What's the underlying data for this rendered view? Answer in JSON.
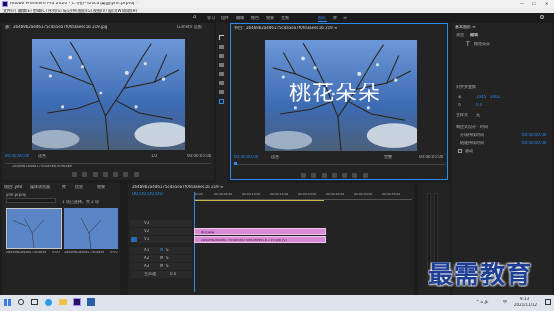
{
  "titlebar": {
    "app_title": "Adobe Premiere Pro 2020 - C:\\用户\\0\\lcu\\桌面\\yml.prproj *",
    "controls": [
      "—",
      "☐",
      "✕"
    ]
  },
  "menubar": {
    "items": [
      "文件(F)",
      "编辑(E)",
      "剪辑(C)",
      "序列(S)",
      "标记(M)",
      "图形(G)",
      "视图(V)",
      "窗口(W)",
      "帮助(H)"
    ]
  },
  "workspace_tabs": {
    "home": "⌂",
    "items": [
      "学习",
      "组件",
      "编辑",
      "颜色",
      "效果",
      "音频",
      "图形",
      "库",
      "≫"
    ],
    "active_index": 6
  },
  "source_monitor": {
    "tab": "源：2b4b9b2a4d6175c4a5ea7f0fd3aeec1b 219.jpg",
    "alt_tab": "Lumetri 范围",
    "timecode_left": "00;00;00;00",
    "fit": "适合",
    "page": "1/2",
    "timecode_right": "00:00:05:00",
    "clip_label": "2b4b9b2a4d6175c4a5ea7f0fd3aeec1b 219.jpg"
  },
  "program_monitor": {
    "tab": "节目：2b4b9b2a4d6175c4a5ea7f0fd3aeec1b 219 ≡",
    "overlay_title": "桃花朵朵",
    "timecode_left": "00;00;00;00",
    "fit": "适合",
    "quality": "完整",
    "timecode_right": "00:00:05:00"
  },
  "effect_controls": {
    "title": "基本图形 ≡",
    "tabs": [
      "浏览",
      "编辑"
    ],
    "layer_name": "桃花朵朵",
    "section_align": "对齐并变换",
    "fields": [
      {
        "label": "⊕",
        "value": "1045",
        "value2": "1061"
      },
      {
        "label": "↻",
        "value": "0.0",
        "value2": ""
      }
    ],
    "section_master": "主样式",
    "master_value": "无",
    "section_text": "响应式设计 - 时间",
    "items": [
      {
        "label": "开场持续时间",
        "value": "00:00:00:00"
      },
      {
        "label": "结尾持续时间",
        "value": "00:00:00:00"
      },
      {
        "label": "滚动",
        "value": ""
      }
    ]
  },
  "project_panel": {
    "tabs": [
      "项目: yml",
      "媒体浏览器",
      "库",
      "信息",
      "效果"
    ],
    "path": "yml.prproj",
    "count": "1 项已选择，共 2 项",
    "items": [
      {
        "name": "2b4b9b2a4d6175c4a5ea7f0fd3aeec1b 219.jpg",
        "duration": "5:00"
      },
      {
        "name": "2b4b9b2a4d6175c4a5ea7f0fd3aeec1b 219",
        "duration": "5:00"
      }
    ]
  },
  "timeline": {
    "tab": "2b4b9b2a4d6175c4a5ea7f0fd3aeec1b 219 ≡",
    "timecode": "00;00;00;00",
    "ruler": [
      "00;00",
      "00;00;05;00",
      "00;00;10;00",
      "00;00;15;00",
      "00;00;20;00",
      "00;00;25;00",
      "00;00;30;00",
      "00;00;35;00"
    ],
    "video_tracks": [
      "V3",
      "V2",
      "V1"
    ],
    "audio_tracks": [
      "A1",
      "A2",
      "A3"
    ],
    "master": "主声道",
    "master_value": "0.0",
    "clip_title": "桃花朵朵",
    "clip_image": "2b4b9b2a4d6175c4a5ea7f0fd3aeec1b 219.jpg [V]"
  },
  "taskbar": {
    "time": "9:13",
    "date": "2021/11/12",
    "lang": "中",
    "tray": "^ ⌂ 🔊"
  },
  "watermark": "最需教育",
  "colors": {
    "accent": "#2d8ceb",
    "clip_pink": "#d98ad5",
    "sky": "#3a5f9a"
  }
}
